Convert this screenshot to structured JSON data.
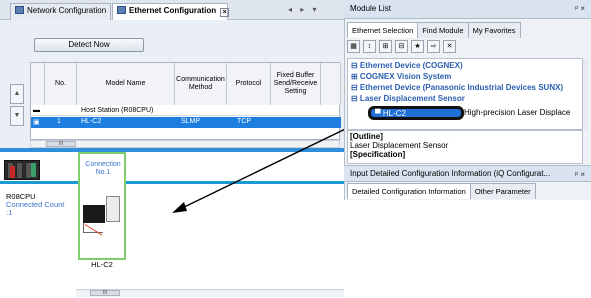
{
  "left_tabs": {
    "tab1": "Network Configuration",
    "tab2": "Ethernet Configuration",
    "close_symbol": "×",
    "nav": "◂ ▸ ▾"
  },
  "toolbar": {
    "detect_now": "Detect Now"
  },
  "grid": {
    "headers": [
      "No.",
      "Model Name",
      "Communication Method",
      "Protocol",
      "Fixed Buffer Send/Receive Setting"
    ],
    "rows": [
      {
        "no": "",
        "model": "Host Station (R08CPU)",
        "comm": "",
        "protocol": ""
      },
      {
        "no": "1",
        "model": "HL-C2",
        "comm": "SLMP",
        "protocol": "TCP"
      }
    ]
  },
  "canvas": {
    "cpu_name": "R08CPU",
    "connected_count_label": "Connected Count",
    "connected_count": ":1",
    "connection_label": "Connection No.1",
    "device_name": "HL-C2"
  },
  "module_list": {
    "title": "Module List",
    "pin": "ᵖ ×",
    "tabs": [
      "Ethernet Selection",
      "Find Module",
      "My Favorites"
    ],
    "tree": [
      "⊟ Ethernet Device (COGNEX)",
      "  ⊞ COGNEX Vision System",
      "⊟ Ethernet Device (Panasonic Industrial Devices SUNX)",
      "  ⊟ Laser Displacement Sensor"
    ],
    "selected_item": "HL-C2",
    "selected_desc": "High-precision Laser Displace",
    "outline_heading": "[Outline]",
    "outline_text": "Laser Displacement Sensor",
    "spec_heading": "[Specification]"
  },
  "input_panel": {
    "title": "Input Detailed Configuration Information (iQ Configurat...",
    "pin": "ᵖ ×",
    "tabs": [
      "Detailed Configuration Information",
      "Other Parameter"
    ]
  },
  "colors": {
    "accent": "#1d7ee0",
    "network_line": "#1b9ad6",
    "device_border": "#7ed06c"
  }
}
